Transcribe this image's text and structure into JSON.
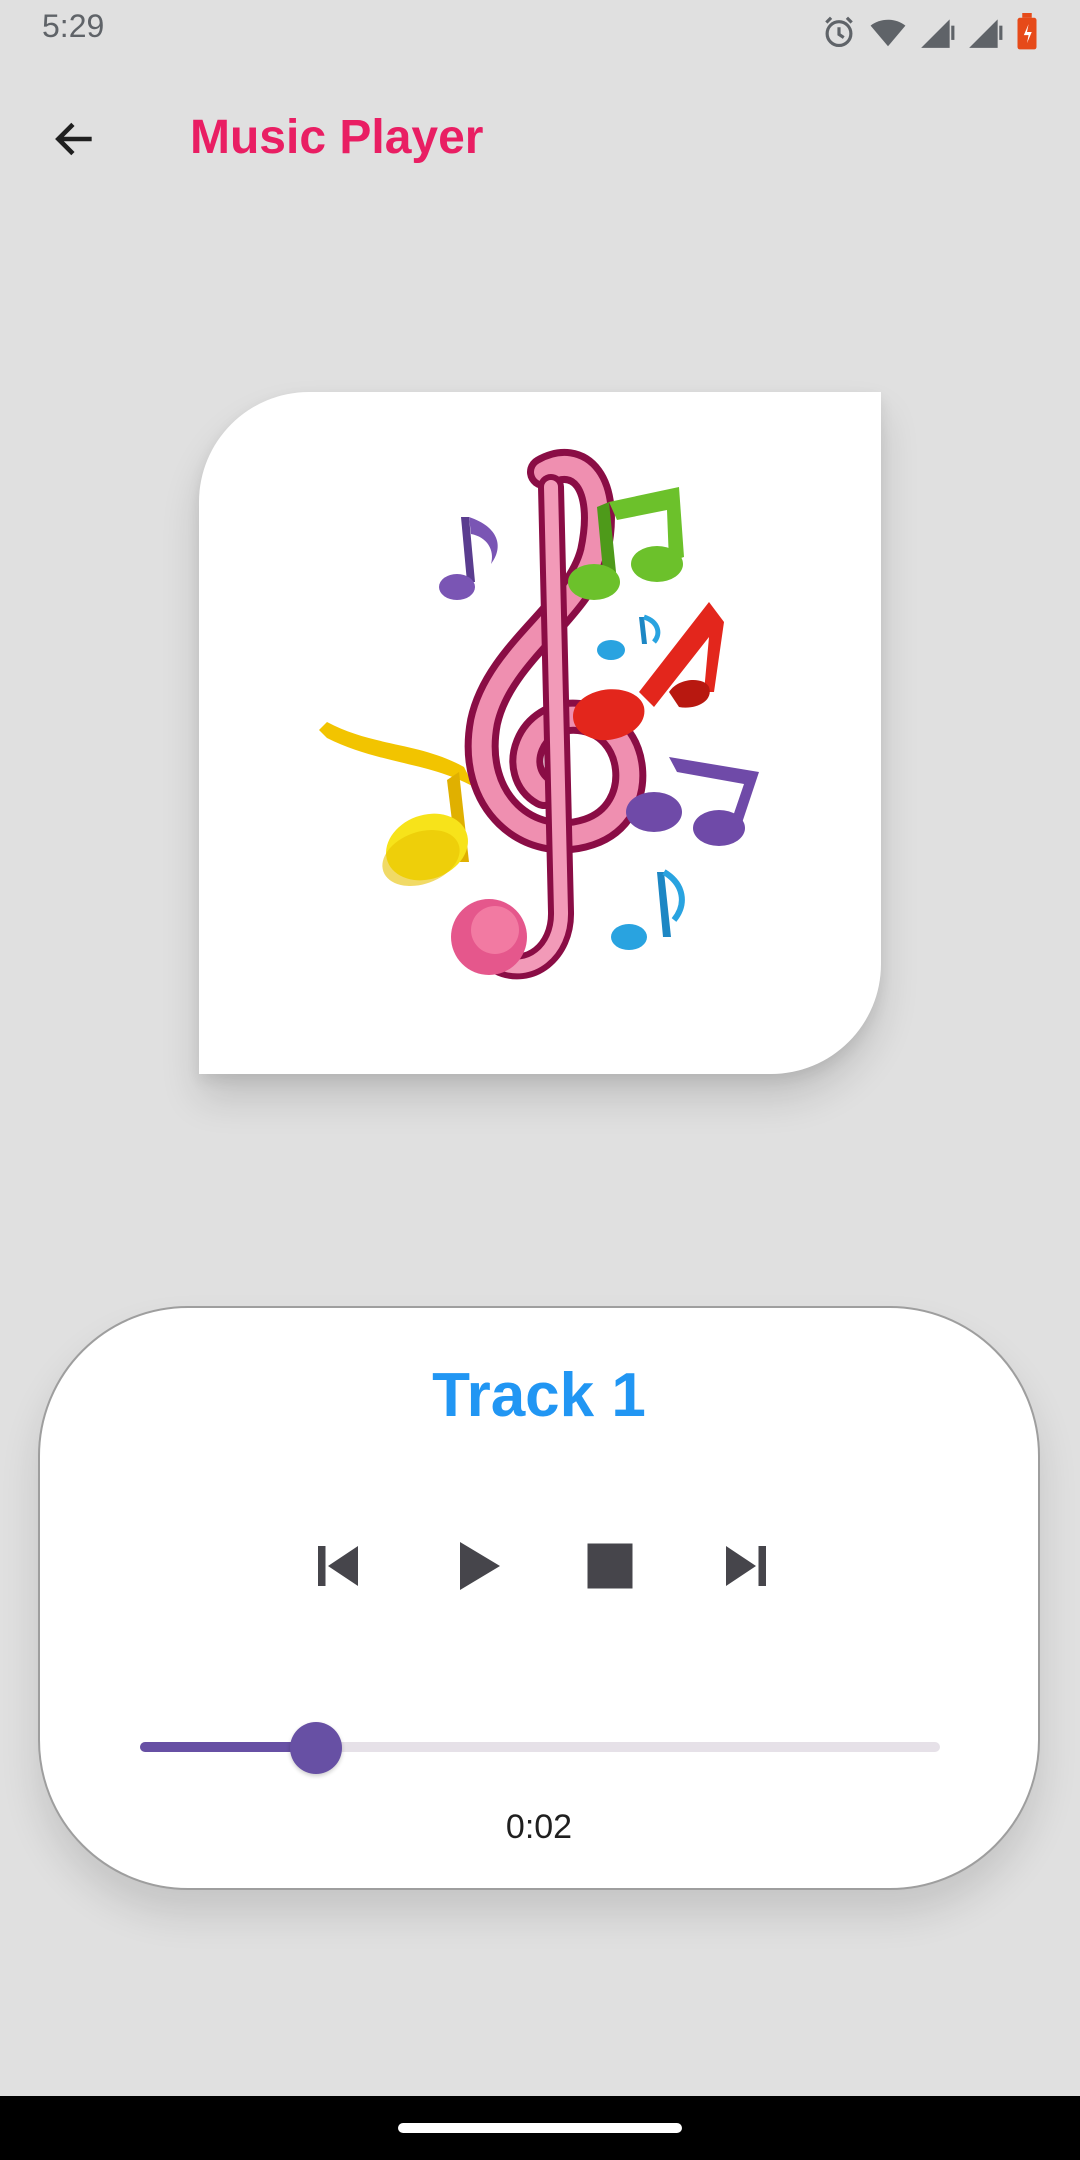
{
  "status": {
    "time": "5:29"
  },
  "app_bar": {
    "title": "Music Player",
    "back_icon": "arrow-back-icon"
  },
  "artwork": {
    "icon": "music-notes-illustration"
  },
  "player": {
    "track_title": "Track 1",
    "controls": [
      "skip-previous-icon",
      "play-icon",
      "stop-icon",
      "skip-next-icon"
    ],
    "progress_fraction": 0.22,
    "elapsed": "0:02"
  },
  "colors": {
    "title": "#e91e63",
    "track_title": "#2196f3",
    "slider": "#6750a4",
    "background": "#e0e0e0"
  }
}
